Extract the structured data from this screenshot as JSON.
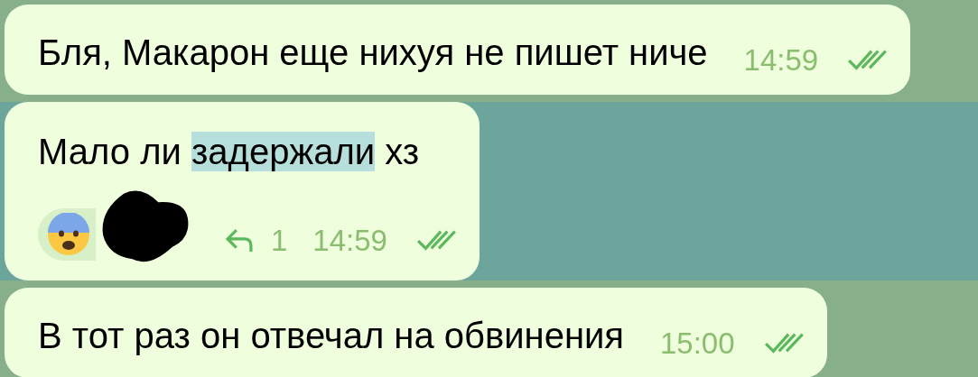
{
  "messages": [
    {
      "text_parts": [
        {
          "text": "Бля, Макарон еще нихуя не пишет ниче",
          "highlighted": false
        }
      ],
      "time": "14:59",
      "read": true,
      "selected": false
    },
    {
      "text_parts": [
        {
          "text": "Мало ли ",
          "highlighted": false
        },
        {
          "text": "задержали",
          "highlighted": true
        },
        {
          "text": " хз",
          "highlighted": false
        }
      ],
      "reaction": {
        "kind": "fearful"
      },
      "replies": "1",
      "time": "14:59",
      "read": true,
      "selected": true
    },
    {
      "text_parts": [
        {
          "text": "В тот раз он отвечал на обвинения",
          "highlighted": false
        }
      ],
      "time": "15:00",
      "read": true,
      "selected": false
    }
  ]
}
